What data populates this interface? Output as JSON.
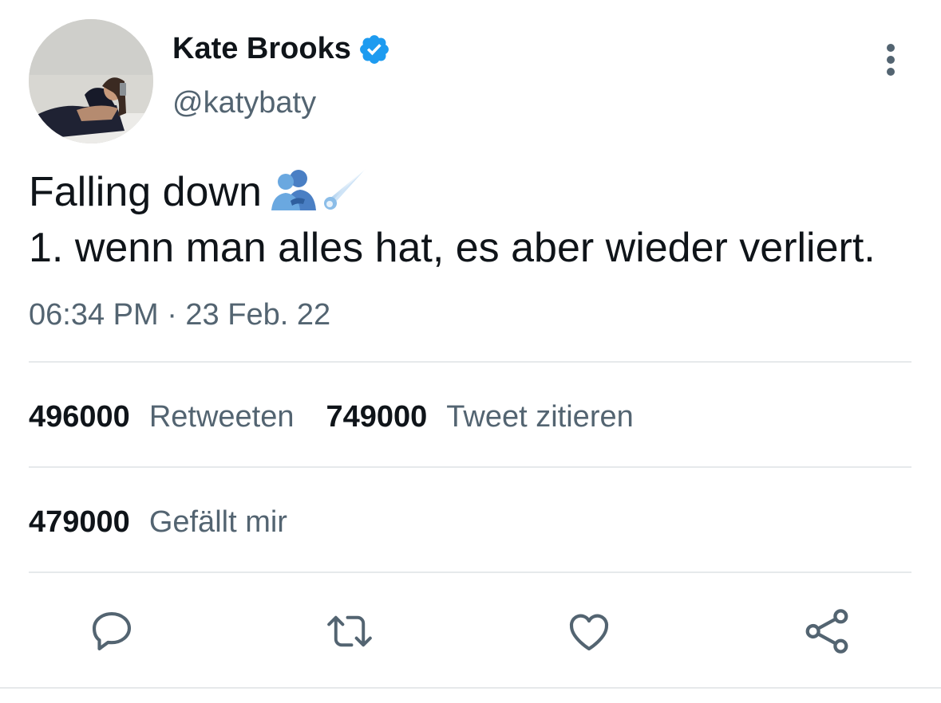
{
  "tweet": {
    "display_name": "Kate Brooks",
    "verified_icon": "verified-badge-icon",
    "handle": "@katybaty",
    "text_line_1": "Falling down",
    "emojis": [
      "people-hugging-emoji",
      "comet-emoji"
    ],
    "text_line_2": "1. wenn man alles hat, es aber wieder verliert.",
    "timestamp": "06:34 PM · 23 Feb. 22"
  },
  "stats": {
    "retweets_count": "496000",
    "retweets_label": "Retweeten",
    "quotes_count": "749000",
    "quotes_label": "Tweet zitieren",
    "likes_count": "479000",
    "likes_label": "Gefällt mir"
  },
  "actions": [
    "reply-icon",
    "retweet-icon",
    "like-icon",
    "share-icon"
  ],
  "colors": {
    "text_primary": "#0f1419",
    "text_secondary": "#536471",
    "verified_blue": "#1d9bf0",
    "divider": "#e6e9eb"
  }
}
